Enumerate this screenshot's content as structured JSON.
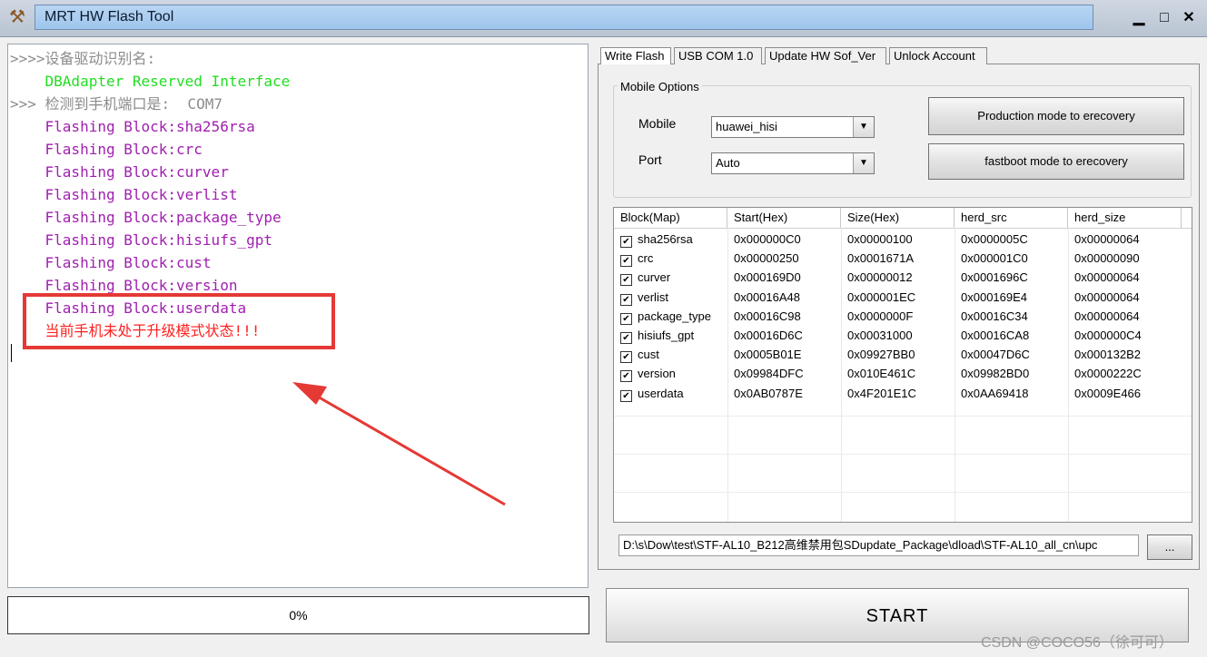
{
  "window": {
    "title": "MRT HW Flash Tool",
    "app_icon": "wrench-icon",
    "minimize_glyph": "▁",
    "maximize_glyph": "□",
    "close_glyph": "✕"
  },
  "log": {
    "lines": [
      {
        "text": ">>>>设备驱动识别名:",
        "color": "#8c8c8c"
      },
      {
        "text": "    DBAdapter Reserved Interface",
        "color": "#22dd22"
      },
      {
        "text": ">>> 检测到手机端口是:  COM7",
        "color": "#8c8c8c"
      },
      {
        "text": "    Flashing Block:sha256rsa",
        "color": "#a020b0"
      },
      {
        "text": "    Flashing Block:crc",
        "color": "#a020b0"
      },
      {
        "text": "    Flashing Block:curver",
        "color": "#a020b0"
      },
      {
        "text": "    Flashing Block:verlist",
        "color": "#a020b0"
      },
      {
        "text": "    Flashing Block:package_type",
        "color": "#a020b0"
      },
      {
        "text": "    Flashing Block:hisiufs_gpt",
        "color": "#a020b0"
      },
      {
        "text": "    Flashing Block:cust",
        "color": "#a020b0"
      },
      {
        "text": "    Flashing Block:version",
        "color": "#a020b0"
      },
      {
        "text": "    Flashing Block:userdata",
        "color": "#a020b0"
      },
      {
        "text": "    当前手机未处于升级模式状态!!!",
        "color": "#ff2020"
      }
    ]
  },
  "progress": {
    "label": "0%",
    "value": 0
  },
  "tabs": [
    "Write Flash",
    "USB COM 1.0",
    "Update HW Sof_Ver",
    "Unlock Account"
  ],
  "mobile_options": {
    "group_title": "Mobile Options",
    "mobile_label": "Mobile",
    "mobile_value": "huawei_hisi",
    "port_label": "Port",
    "port_value": "Auto",
    "production_button": "Production mode to erecovery",
    "fastboot_button": "fastboot mode to erecovery"
  },
  "grid": {
    "headers": [
      "Block(Map)",
      "Start(Hex)",
      "Size(Hex)",
      "herd_src",
      "herd_size"
    ],
    "rows": [
      {
        "name": "sha256rsa",
        "start": "0x000000C0",
        "size": "0x00000100",
        "src": "0x0000005C",
        "hsize": "0x00000064",
        "checked": true
      },
      {
        "name": "crc",
        "start": "0x00000250",
        "size": "0x0001671A",
        "src": "0x000001C0",
        "hsize": "0x00000090",
        "checked": true
      },
      {
        "name": "curver",
        "start": "0x000169D0",
        "size": "0x00000012",
        "src": "0x0001696C",
        "hsize": "0x00000064",
        "checked": true
      },
      {
        "name": "verlist",
        "start": "0x00016A48",
        "size": "0x000001EC",
        "src": "0x000169E4",
        "hsize": "0x00000064",
        "checked": true
      },
      {
        "name": "package_type",
        "start": "0x00016C98",
        "size": "0x0000000F",
        "src": "0x00016C34",
        "hsize": "0x00000064",
        "checked": true
      },
      {
        "name": "hisiufs_gpt",
        "start": "0x00016D6C",
        "size": "0x00031000",
        "src": "0x00016CA8",
        "hsize": "0x000000C4",
        "checked": true
      },
      {
        "name": "cust",
        "start": "0x0005B01E",
        "size": "0x09927BB0",
        "src": "0x00047D6C",
        "hsize": "0x000132B2",
        "checked": true
      },
      {
        "name": "version",
        "start": "0x09984DFC",
        "size": "0x010E461C",
        "src": "0x09982BD0",
        "hsize": "0x0000222C",
        "checked": true
      },
      {
        "name": "userdata",
        "start": "0x0AB0787E",
        "size": "0x4F201E1C",
        "src": "0x0AA69418",
        "hsize": "0x0009E466",
        "checked": true
      }
    ]
  },
  "file": {
    "path": "D:\\s\\Dow\\test\\STF-AL10_B212高维禁用包SDupdate_Package\\dload\\STF-AL10_all_cn\\upc",
    "browse_label": "..."
  },
  "start_button": "START",
  "watermark": "CSDN @COCO56（徐可可）",
  "colors": {
    "annotation": "#e53935",
    "title_bar": "#a9cbee"
  }
}
